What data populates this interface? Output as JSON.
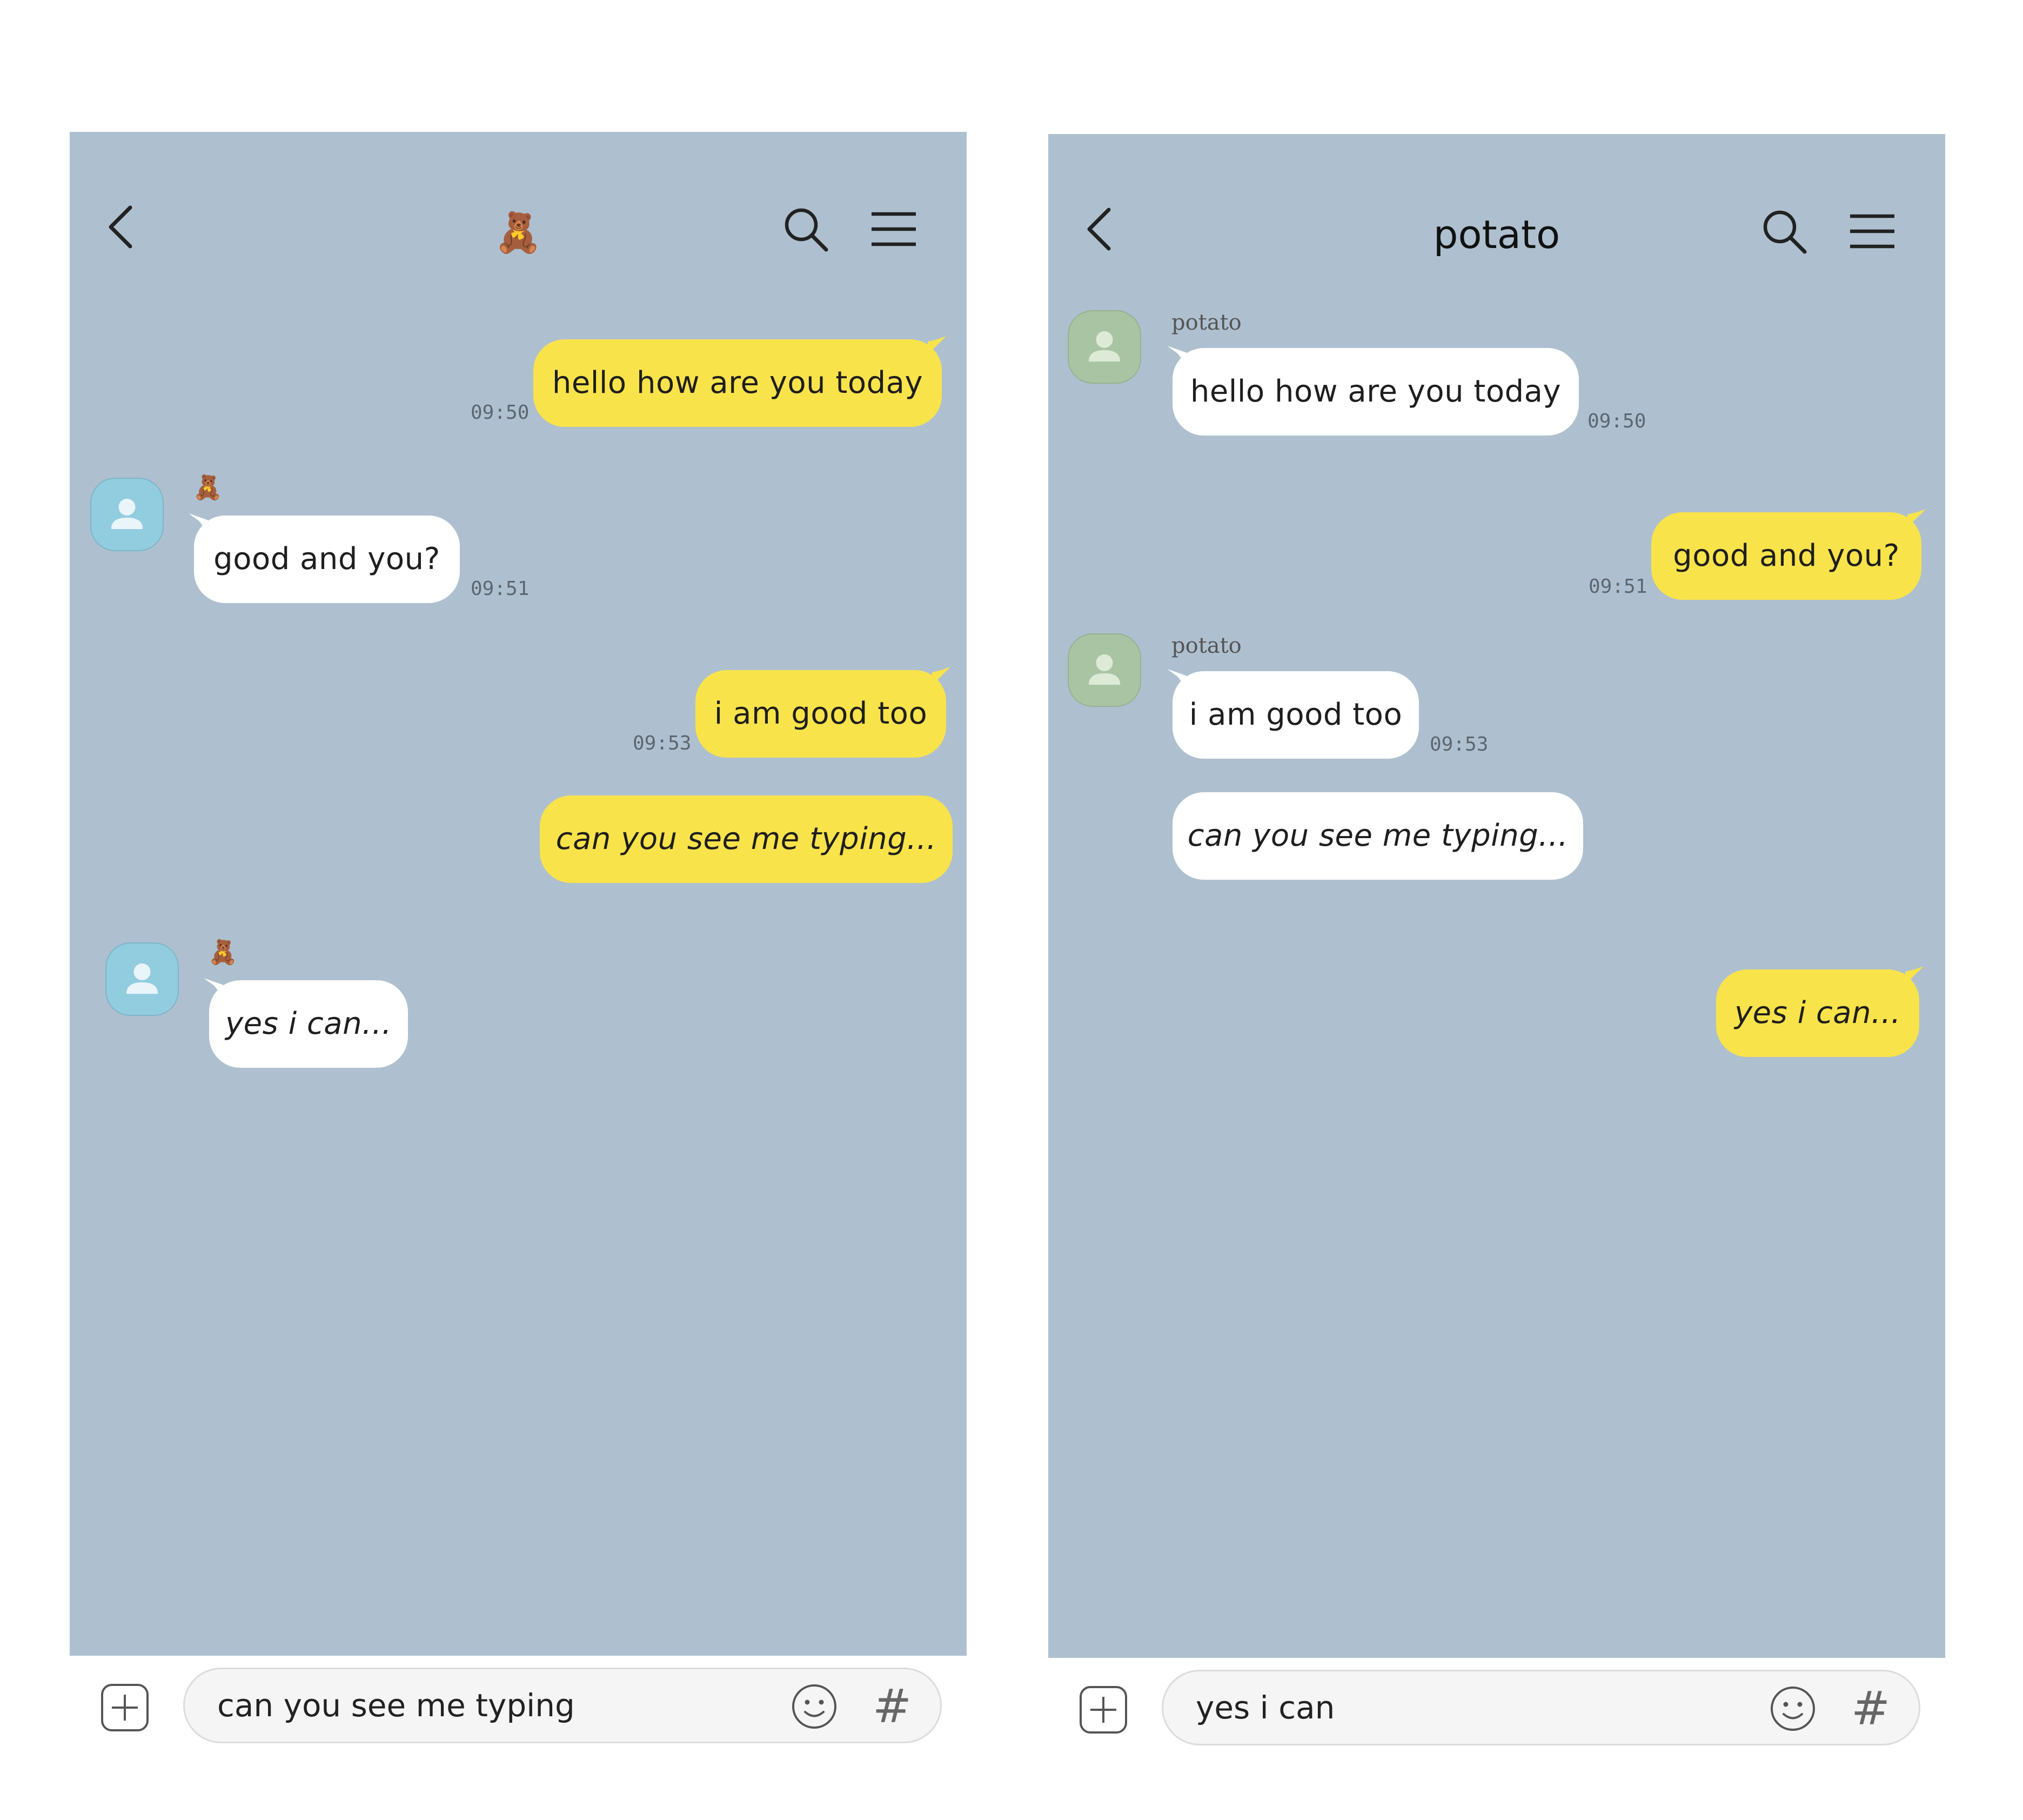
{
  "left_screen": {
    "header": {
      "title": "🧸"
    },
    "messages": [
      {
        "type": "outgoing",
        "text": "hello how are you today",
        "time": "09:50"
      },
      {
        "type": "incoming",
        "sender": "🧸",
        "text": "good and you?",
        "time": "09:51"
      },
      {
        "type": "outgoing",
        "text": "i am good too",
        "time": "09:53"
      },
      {
        "type": "outgoing",
        "text": "can you see me typing..."
      },
      {
        "type": "incoming",
        "sender": "🧸",
        "text": "yes i can..."
      }
    ],
    "input": {
      "value": "can you see me typing"
    }
  },
  "right_screen": {
    "header": {
      "title": "potato"
    },
    "messages": [
      {
        "type": "incoming",
        "sender": "potato",
        "text": "hello how are you today",
        "time": "09:50"
      },
      {
        "type": "outgoing",
        "text": "good and you?",
        "time": "09:51"
      },
      {
        "type": "incoming",
        "sender": "potato",
        "text": "i am good too",
        "time": "09:53"
      },
      {
        "type": "incoming",
        "text": "can you see me typing..."
      },
      {
        "type": "outgoing",
        "text": "yes i can..."
      }
    ],
    "input": {
      "value": "yes i can"
    }
  },
  "icons": {
    "back": "chevron-left-icon",
    "search": "search-icon",
    "menu": "hamburger-menu-icon",
    "attach": "plus-square-icon",
    "emoji": "smiley-icon",
    "hashtag": "hash-icon",
    "avatar": "person-icon"
  },
  "hashtag_symbol": "#",
  "colors": {
    "chat_background": "#aec0cf",
    "outgoing_bubble": "#f9e34a",
    "incoming_bubble": "#ffffff",
    "avatar_left": "#92ccdf",
    "avatar_right": "#a9c4a3"
  }
}
